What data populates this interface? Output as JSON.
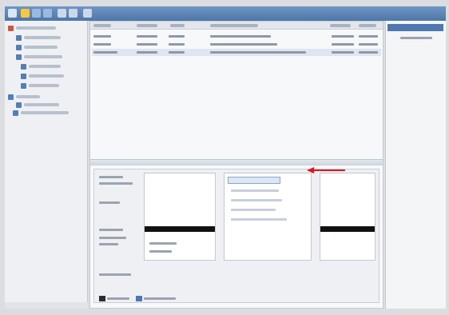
{
  "window": {
    "title": ""
  },
  "nav": {
    "items": [
      "",
      "",
      "",
      "",
      "",
      "",
      "",
      "",
      "",
      "",
      ""
    ]
  },
  "list": {
    "headers": [
      "",
      "",
      "",
      "",
      "",
      ""
    ],
    "rows": [
      [
        "",
        "",
        "",
        "",
        "",
        ""
      ],
      [
        "",
        "",
        "",
        "",
        "",
        ""
      ],
      [
        "",
        "",
        "",
        "",
        "",
        ""
      ]
    ]
  },
  "details": {
    "left_labels": [
      "",
      "",
      "",
      "",
      "",
      "",
      ""
    ],
    "middle_items": [
      "",
      "",
      "",
      "",
      ""
    ],
    "bottom_legend": [
      "",
      ""
    ]
  },
  "actions": {
    "items": [
      ""
    ]
  },
  "colors": {
    "title_bar": "#4d76a8",
    "selection": "#4f78b0",
    "annotation_arrow": "#e0161c"
  }
}
